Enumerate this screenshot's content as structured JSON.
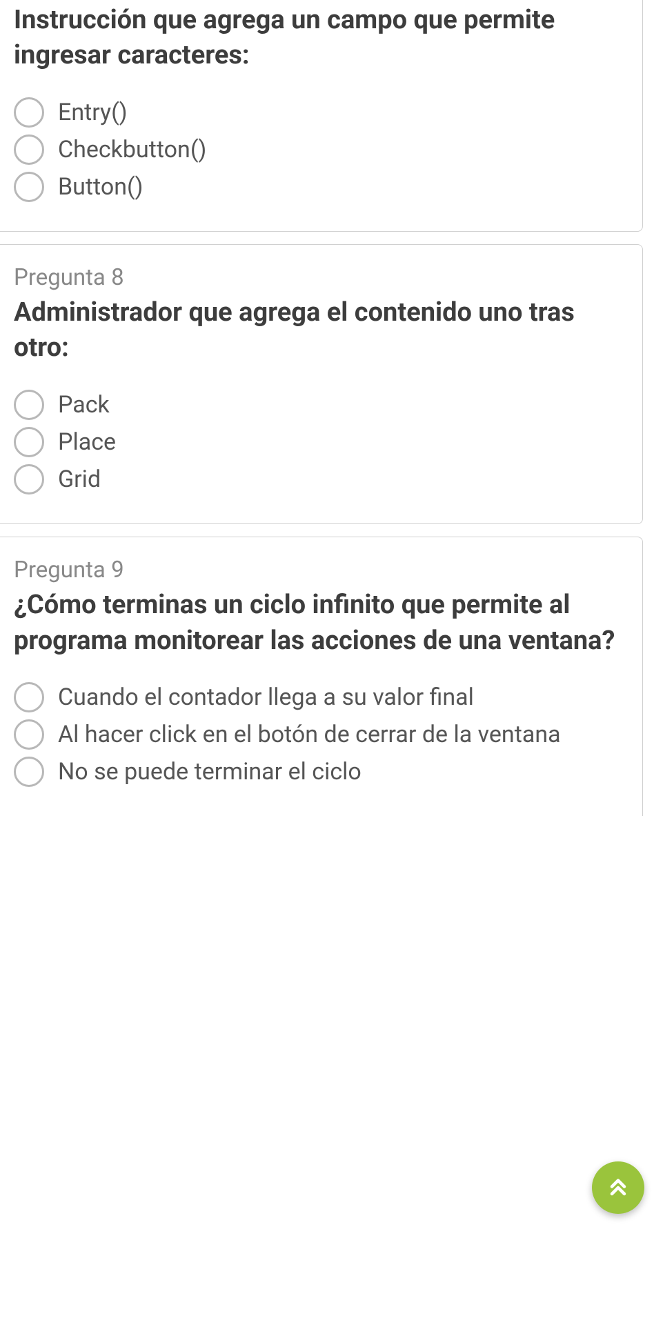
{
  "questions": [
    {
      "label": "",
      "text": "Instrucción que agrega un campo que permite ingresar caracteres:",
      "options": [
        "Entry()",
        "Checkbutton()",
        "Button()"
      ]
    },
    {
      "label": "Pregunta 8",
      "text": "Administrador que agrega el contenido uno tras otro:",
      "options": [
        "Pack",
        "Place",
        "Grid"
      ]
    },
    {
      "label": "Pregunta 9",
      "text": "¿Cómo terminas un ciclo infinito que permite al programa monitorear las acciones de una ventana?",
      "options": [
        "Cuando el contador llega a su valor final",
        "Al hacer click en el botón de cerrar de la ventana",
        "No se puede terminar el ciclo"
      ]
    }
  ]
}
